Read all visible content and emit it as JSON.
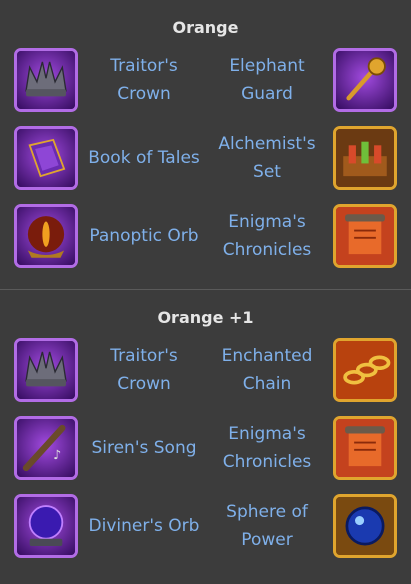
{
  "sections": [
    {
      "title": "Orange",
      "rows": [
        {
          "left": {
            "name": "Traitor's Crown",
            "icon": "crown-icon"
          },
          "right": {
            "name": "Elephant Guard",
            "icon": "mace-icon"
          }
        },
        {
          "left": {
            "name": "Book of Tales",
            "icon": "book-icon"
          },
          "right": {
            "name": "Alchemist's Set",
            "icon": "potion-set-icon"
          }
        },
        {
          "left": {
            "name": "Panoptic Orb",
            "icon": "eye-orb-icon"
          },
          "right": {
            "name": "Enigma's Chronicles",
            "icon": "scroll-icon"
          }
        }
      ]
    },
    {
      "title": "Orange +1",
      "rows": [
        {
          "left": {
            "name": "Traitor's Crown",
            "icon": "crown-icon"
          },
          "right": {
            "name": "Enchanted Chain",
            "icon": "chain-icon"
          }
        },
        {
          "left": {
            "name": "Siren's Song",
            "icon": "flute-icon"
          },
          "right": {
            "name": "Enigma's Chronicles",
            "icon": "scroll-icon"
          }
        },
        {
          "left": {
            "name": "Diviner's Orb",
            "icon": "crystal-ball-icon"
          },
          "right": {
            "name": "Sphere of Power",
            "icon": "blue-sphere-icon"
          }
        }
      ]
    }
  ],
  "colors": {
    "background": "#3c3c3c",
    "title": "#e6e6e6",
    "item_name": "#7fb0ea",
    "epic_border": "#b26ce6",
    "legendary_border": "#e0a52e"
  }
}
